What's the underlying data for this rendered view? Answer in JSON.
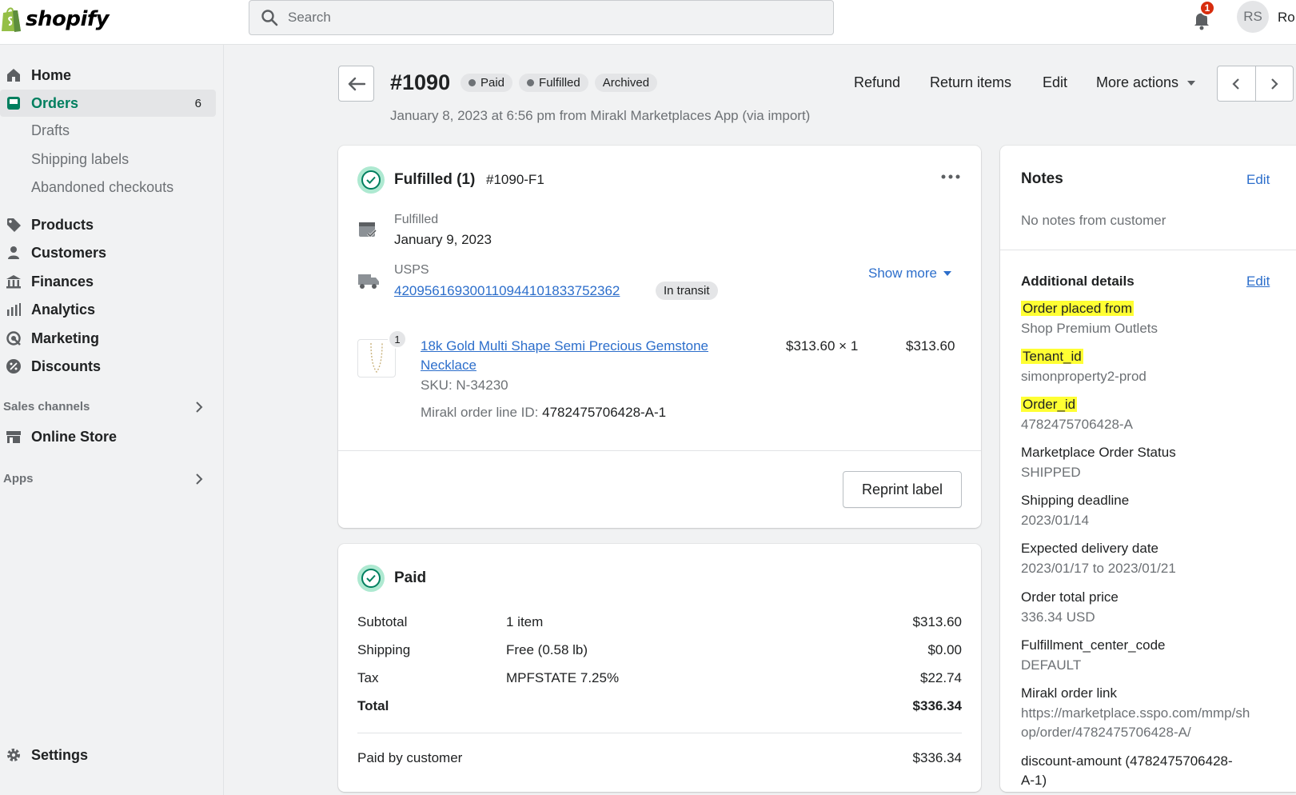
{
  "topbar": {
    "logo_text": "shopify",
    "search_placeholder": "Search",
    "notification_count": "1",
    "avatar_initials": "RS",
    "user_name": "Ro"
  },
  "sidebar": {
    "home": "Home",
    "orders": "Orders",
    "orders_count": "6",
    "drafts": "Drafts",
    "shipping_labels": "Shipping labels",
    "abandoned_checkouts": "Abandoned checkouts",
    "products": "Products",
    "customers": "Customers",
    "finances": "Finances",
    "analytics": "Analytics",
    "marketing": "Marketing",
    "discounts": "Discounts",
    "sales_channels": "Sales channels",
    "online_store": "Online Store",
    "apps": "Apps",
    "settings": "Settings"
  },
  "header": {
    "order_number": "#1090",
    "badges": [
      "Paid",
      "Fulfilled",
      "Archived"
    ],
    "subtitle": "January 8, 2023 at 6:56 pm from Mirakl Marketplaces App (via import)",
    "refund": "Refund",
    "return_items": "Return items",
    "edit": "Edit",
    "more_actions": "More actions"
  },
  "fulfillment": {
    "title": "Fulfilled (1)",
    "id": "#1090-F1",
    "status_label": "Fulfilled",
    "date": "January 9, 2023",
    "carrier": "USPS",
    "tracking_number": "420956169300110944101833752362",
    "tracking_status": "In transit",
    "show_more": "Show more",
    "item_qty_badge": "1",
    "item_name_line1": "18k Gold Multi Shape Semi Precious Gemstone",
    "item_name_line2": "Necklace",
    "sku": "SKU: N-34230",
    "line_id_label": "Mirakl order line ID:",
    "line_id_value": "4782475706428-A-1",
    "unit_price": "$313.60 × 1",
    "line_total": "$313.60",
    "reprint_label": "Reprint label"
  },
  "payment": {
    "title": "Paid",
    "rows": [
      {
        "label": "Subtotal",
        "desc": "1 item",
        "amount": "$313.60"
      },
      {
        "label": "Shipping",
        "desc": "Free (0.58 lb)",
        "amount": "$0.00"
      },
      {
        "label": "Tax",
        "desc": "MPFSTATE 7.25%",
        "amount": "$22.74"
      },
      {
        "label": "Total",
        "desc": "",
        "amount": "$336.34"
      }
    ],
    "paid_by_label": "Paid by customer",
    "paid_by_amount": "$336.34"
  },
  "notes": {
    "title": "Notes",
    "edit": "Edit",
    "body": "No notes from customer"
  },
  "additional": {
    "title": "Additional details",
    "edit": "Edit",
    "fields": [
      {
        "label": "Order placed from",
        "value": "Shop Premium Outlets"
      },
      {
        "label": "Tenant_id",
        "value": "simonproperty2-prod"
      },
      {
        "label": "Order_id",
        "value": "4782475706428-A"
      },
      {
        "label": "Marketplace Order Status",
        "value": "SHIPPED"
      },
      {
        "label": "Shipping deadline",
        "value": "2023/01/14"
      },
      {
        "label": "Expected delivery date",
        "value": "2023/01/17 to 2023/01/21"
      },
      {
        "label": "Order total price",
        "value": "336.34 USD"
      },
      {
        "label": "Fulfillment_center_code",
        "value": "DEFAULT"
      },
      {
        "label": "Mirakl order link",
        "value_line1": "https://marketplace.sspo.com/mmp/sh",
        "value_line2": "op/order/4782475706428-A/"
      },
      {
        "label_line1": "discount-amount (4782475706428-",
        "label_line2": "A-1)"
      }
    ]
  },
  "colors": {
    "accent": "#007f5f",
    "link": "#2c6ecb",
    "highlight": "#ffff33",
    "badge_bg": "#e4e5e7"
  }
}
